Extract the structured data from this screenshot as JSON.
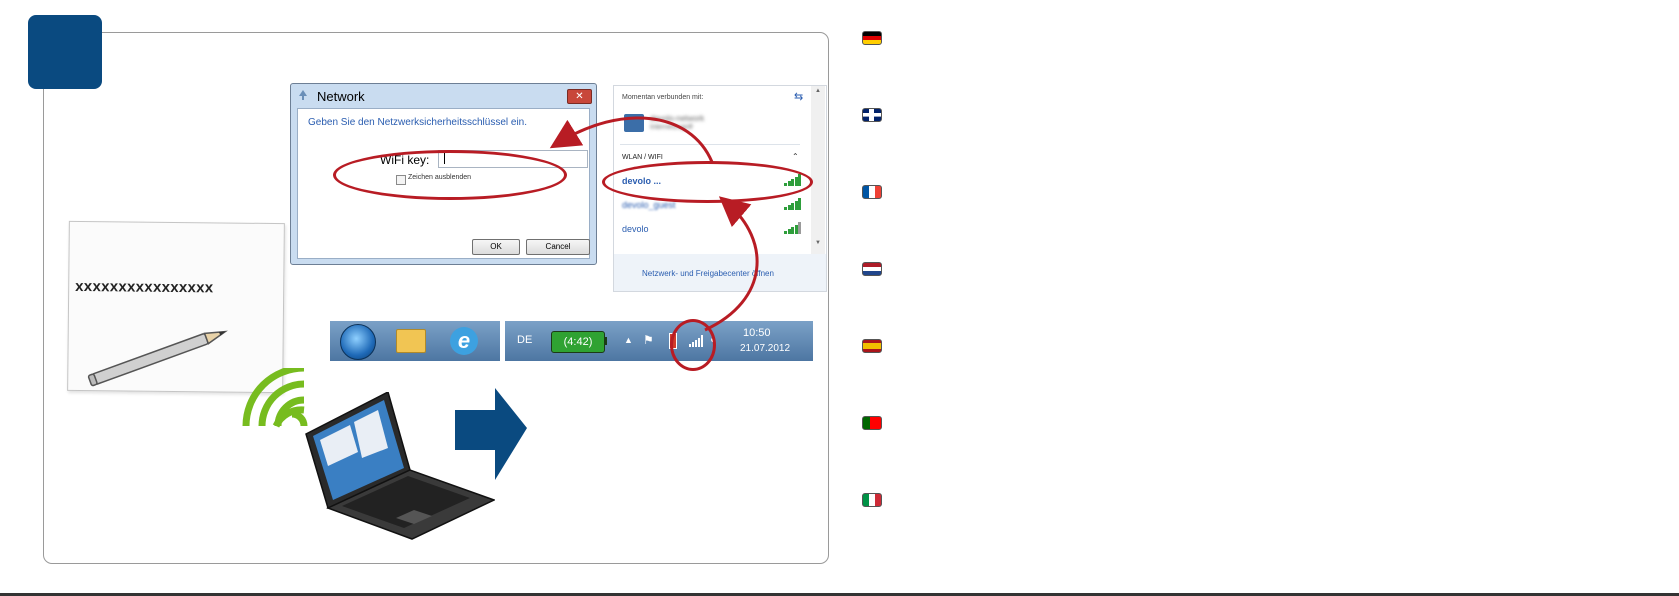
{
  "dialog": {
    "title": "Network",
    "close_glyph": "✕",
    "instruction": "Geben Sie den Netzwerksicherheitsschlüssel ein.",
    "field_label": "WiFi key:",
    "field_value": "",
    "checkbox_label": "Zeichen ausblenden",
    "ok_label": "OK",
    "cancel_label": "Cancel"
  },
  "network_list": {
    "header": "Momentan verbunden mit:",
    "connected_name": "devolo-network",
    "connected_sub": "Internetzugriff",
    "section": "WLAN / WIFI",
    "items": [
      {
        "label": "devolo ...",
        "signal": 5
      },
      {
        "label": "devolo_guest",
        "signal": 5
      },
      {
        "label": "devolo",
        "signal": 4
      }
    ],
    "footer": "Netzwerk- und Freigabecenter öffnen"
  },
  "paper": {
    "key_text": "xxxxxxxxxxxxxxxx"
  },
  "taskbar": {
    "language": "DE",
    "battery": "(4:42)",
    "time": "10:50",
    "date": "21.07.2012"
  },
  "flags": [
    {
      "country": "germany",
      "colors": [
        "#000000",
        "#dd0000",
        "#ffce00"
      ],
      "orientation": "horizontal"
    },
    {
      "country": "united-kingdom",
      "colors": [
        "#012169",
        "#ffffff",
        "#c8102e"
      ],
      "orientation": "union"
    },
    {
      "country": "france",
      "colors": [
        "#0055a4",
        "#ffffff",
        "#ef4135"
      ],
      "orientation": "vertical"
    },
    {
      "country": "netherlands",
      "colors": [
        "#ae1c28",
        "#ffffff",
        "#21468b"
      ],
      "orientation": "horizontal"
    },
    {
      "country": "spain",
      "colors": [
        "#aa151b",
        "#f1bf00",
        "#aa151b"
      ],
      "orientation": "spain"
    },
    {
      "country": "portugal",
      "colors": [
        "#006600",
        "#ff0000",
        "#ff0000"
      ],
      "orientation": "portugal"
    },
    {
      "country": "italy",
      "colors": [
        "#009246",
        "#ffffff",
        "#ce2b37"
      ],
      "orientation": "vertical"
    }
  ],
  "colors": {
    "step_badge": "#0a4a80",
    "highlight": "#b81c24",
    "wifi": "#77bc1f",
    "arrow": "#0a4a80"
  }
}
